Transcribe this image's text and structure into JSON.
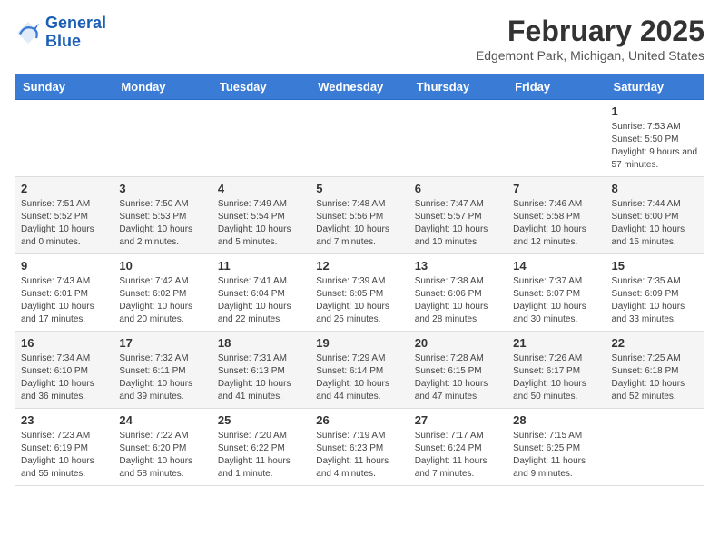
{
  "header": {
    "logo_line1": "General",
    "logo_line2": "Blue",
    "month": "February 2025",
    "location": "Edgemont Park, Michigan, United States"
  },
  "weekdays": [
    "Sunday",
    "Monday",
    "Tuesday",
    "Wednesday",
    "Thursday",
    "Friday",
    "Saturday"
  ],
  "weeks": [
    [
      {
        "day": "",
        "info": ""
      },
      {
        "day": "",
        "info": ""
      },
      {
        "day": "",
        "info": ""
      },
      {
        "day": "",
        "info": ""
      },
      {
        "day": "",
        "info": ""
      },
      {
        "day": "",
        "info": ""
      },
      {
        "day": "1",
        "info": "Sunrise: 7:53 AM\nSunset: 5:50 PM\nDaylight: 9 hours and 57 minutes."
      }
    ],
    [
      {
        "day": "2",
        "info": "Sunrise: 7:51 AM\nSunset: 5:52 PM\nDaylight: 10 hours and 0 minutes."
      },
      {
        "day": "3",
        "info": "Sunrise: 7:50 AM\nSunset: 5:53 PM\nDaylight: 10 hours and 2 minutes."
      },
      {
        "day": "4",
        "info": "Sunrise: 7:49 AM\nSunset: 5:54 PM\nDaylight: 10 hours and 5 minutes."
      },
      {
        "day": "5",
        "info": "Sunrise: 7:48 AM\nSunset: 5:56 PM\nDaylight: 10 hours and 7 minutes."
      },
      {
        "day": "6",
        "info": "Sunrise: 7:47 AM\nSunset: 5:57 PM\nDaylight: 10 hours and 10 minutes."
      },
      {
        "day": "7",
        "info": "Sunrise: 7:46 AM\nSunset: 5:58 PM\nDaylight: 10 hours and 12 minutes."
      },
      {
        "day": "8",
        "info": "Sunrise: 7:44 AM\nSunset: 6:00 PM\nDaylight: 10 hours and 15 minutes."
      }
    ],
    [
      {
        "day": "9",
        "info": "Sunrise: 7:43 AM\nSunset: 6:01 PM\nDaylight: 10 hours and 17 minutes."
      },
      {
        "day": "10",
        "info": "Sunrise: 7:42 AM\nSunset: 6:02 PM\nDaylight: 10 hours and 20 minutes."
      },
      {
        "day": "11",
        "info": "Sunrise: 7:41 AM\nSunset: 6:04 PM\nDaylight: 10 hours and 22 minutes."
      },
      {
        "day": "12",
        "info": "Sunrise: 7:39 AM\nSunset: 6:05 PM\nDaylight: 10 hours and 25 minutes."
      },
      {
        "day": "13",
        "info": "Sunrise: 7:38 AM\nSunset: 6:06 PM\nDaylight: 10 hours and 28 minutes."
      },
      {
        "day": "14",
        "info": "Sunrise: 7:37 AM\nSunset: 6:07 PM\nDaylight: 10 hours and 30 minutes."
      },
      {
        "day": "15",
        "info": "Sunrise: 7:35 AM\nSunset: 6:09 PM\nDaylight: 10 hours and 33 minutes."
      }
    ],
    [
      {
        "day": "16",
        "info": "Sunrise: 7:34 AM\nSunset: 6:10 PM\nDaylight: 10 hours and 36 minutes."
      },
      {
        "day": "17",
        "info": "Sunrise: 7:32 AM\nSunset: 6:11 PM\nDaylight: 10 hours and 39 minutes."
      },
      {
        "day": "18",
        "info": "Sunrise: 7:31 AM\nSunset: 6:13 PM\nDaylight: 10 hours and 41 minutes."
      },
      {
        "day": "19",
        "info": "Sunrise: 7:29 AM\nSunset: 6:14 PM\nDaylight: 10 hours and 44 minutes."
      },
      {
        "day": "20",
        "info": "Sunrise: 7:28 AM\nSunset: 6:15 PM\nDaylight: 10 hours and 47 minutes."
      },
      {
        "day": "21",
        "info": "Sunrise: 7:26 AM\nSunset: 6:17 PM\nDaylight: 10 hours and 50 minutes."
      },
      {
        "day": "22",
        "info": "Sunrise: 7:25 AM\nSunset: 6:18 PM\nDaylight: 10 hours and 52 minutes."
      }
    ],
    [
      {
        "day": "23",
        "info": "Sunrise: 7:23 AM\nSunset: 6:19 PM\nDaylight: 10 hours and 55 minutes."
      },
      {
        "day": "24",
        "info": "Sunrise: 7:22 AM\nSunset: 6:20 PM\nDaylight: 10 hours and 58 minutes."
      },
      {
        "day": "25",
        "info": "Sunrise: 7:20 AM\nSunset: 6:22 PM\nDaylight: 11 hours and 1 minute."
      },
      {
        "day": "26",
        "info": "Sunrise: 7:19 AM\nSunset: 6:23 PM\nDaylight: 11 hours and 4 minutes."
      },
      {
        "day": "27",
        "info": "Sunrise: 7:17 AM\nSunset: 6:24 PM\nDaylight: 11 hours and 7 minutes."
      },
      {
        "day": "28",
        "info": "Sunrise: 7:15 AM\nSunset: 6:25 PM\nDaylight: 11 hours and 9 minutes."
      },
      {
        "day": "",
        "info": ""
      }
    ]
  ]
}
